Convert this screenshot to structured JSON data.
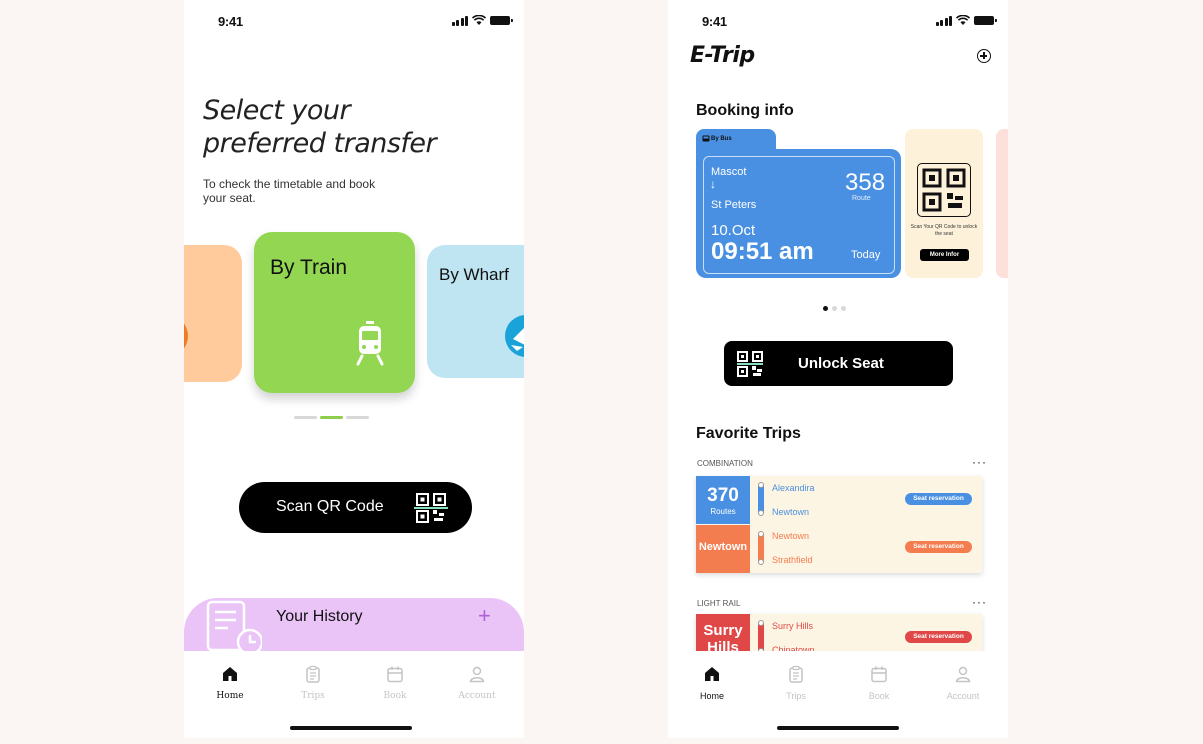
{
  "left": {
    "status_time": "9:41",
    "headline_line1": "Select your",
    "headline_line2": "preferred transfer",
    "subline": "To check the timetable and book your seat.",
    "cards": [
      {
        "label": "By Train",
        "color": "#93d652"
      },
      {
        "label": "By Wharf",
        "color": "#bfe5f2"
      }
    ],
    "carousel_active_index": 1,
    "scan_button": "Scan QR Code",
    "history_title": "Your History",
    "history_add": "+",
    "tabs": [
      {
        "label": "Home",
        "icon": "home-icon",
        "active": true
      },
      {
        "label": "Trips",
        "icon": "clipboard-icon",
        "active": false
      },
      {
        "label": "Book",
        "icon": "calendar-icon",
        "active": false
      },
      {
        "label": "Account",
        "icon": "user-icon",
        "active": false
      }
    ]
  },
  "right": {
    "status_time": "9:41",
    "brand": "E-Trip",
    "booking_title": "Booking info",
    "ticket": {
      "mode": "By Bus",
      "from": "Mascot",
      "arrow": "↓",
      "to": "St Peters",
      "route_number": "358",
      "route_label": "Route",
      "date": "10.Oct",
      "time": "09:51 am",
      "day": "Today",
      "scan_text": "Scan Your QR Code to unlock the seat",
      "more_button": "More Infor",
      "color": "#4a90e2"
    },
    "unlock_button": "Unlock Seat",
    "favorites_title": "Favorite Trips",
    "groups": [
      {
        "label": "COMBINATION",
        "more": "···",
        "rows": [
          {
            "badge_main": "370",
            "badge_sub": "Routes",
            "color": "#4a90e2",
            "stop_from": "Alexandira",
            "stop_to": "Newtown",
            "pill": "Seat reservation"
          },
          {
            "badge_main": "Newtown",
            "badge_sub": "",
            "color": "#f47d4f",
            "stop_from": "Newtown",
            "stop_to": "Strathfield",
            "pill": "Seat reservation"
          }
        ]
      },
      {
        "label": "LIGHT RAIL",
        "more": "···",
        "rows": [
          {
            "badge_main": "Surry Hills",
            "badge_sub": "",
            "color": "#e04848",
            "stop_from": "Surry Hills",
            "stop_to": "Chinatown",
            "pill": "Seat reservation"
          }
        ]
      }
    ],
    "tabs": [
      {
        "label": "Home",
        "icon": "home-icon",
        "active": true
      },
      {
        "label": "Trips",
        "icon": "clipboard-icon",
        "active": false
      },
      {
        "label": "Book",
        "icon": "calendar-icon",
        "active": false
      },
      {
        "label": "Account",
        "icon": "user-icon",
        "active": false
      }
    ]
  }
}
